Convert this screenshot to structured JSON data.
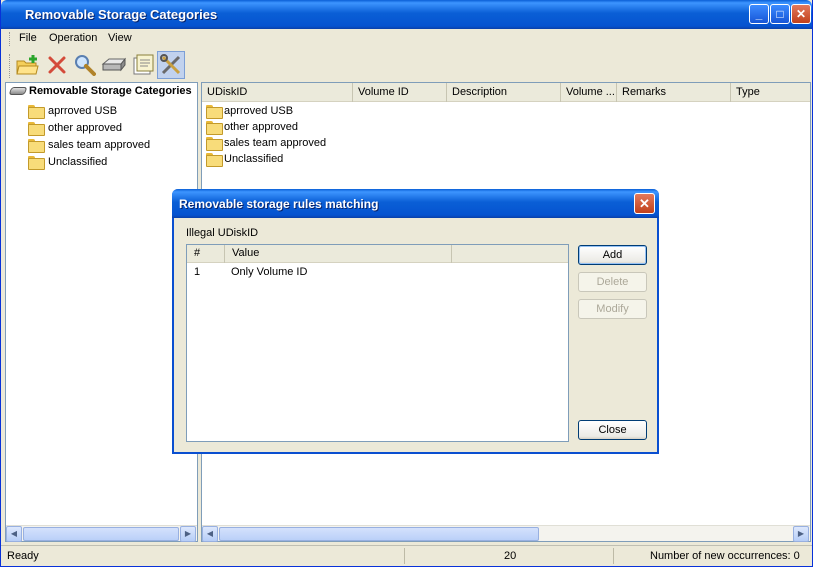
{
  "main_window": {
    "title": "Removable Storage Categories",
    "controls": {
      "minimize": "_",
      "maximize": "□",
      "close": "✕"
    }
  },
  "menu": [
    {
      "label": "File"
    },
    {
      "label": "Operation"
    },
    {
      "label": "View"
    }
  ],
  "toolbar": {
    "buttons": [
      {
        "icon": "new-folder-icon"
      },
      {
        "icon": "delete-icon"
      },
      {
        "icon": "search-icon"
      },
      {
        "icon": "drive-icon"
      },
      {
        "icon": "properties-icon"
      },
      {
        "icon": "tools-icon",
        "active": true
      }
    ]
  },
  "tree": {
    "root_label": "Removable Storage Categories",
    "items": [
      "aprroved USB",
      "other approved",
      "sales team approved",
      "Unclassified"
    ]
  },
  "list": {
    "columns": [
      "UDiskID",
      "Volume ID",
      "Description",
      "Volume ...",
      "Remarks",
      "Type"
    ],
    "rows": [
      "aprroved USB",
      "other approved",
      "sales team approved",
      "Unclassified"
    ]
  },
  "statusbar": {
    "left": "Ready",
    "middle": "20",
    "right": "Number of new occurrences: 0"
  },
  "dialog": {
    "title": "Removable storage rules matching",
    "close": "✕",
    "group_label": "Illegal UDiskID",
    "columns": [
      "#",
      "Value"
    ],
    "rows": [
      {
        "num": "1",
        "value": "Only Volume ID"
      }
    ],
    "buttons": {
      "add": "Add",
      "delete": "Delete",
      "modify": "Modify",
      "close": "Close"
    }
  },
  "colors": {
    "titlebar": "#0a5fd6",
    "window_bg": "#ece9d8",
    "close_button": "#c1401b",
    "disabled_text": "#aca899"
  }
}
